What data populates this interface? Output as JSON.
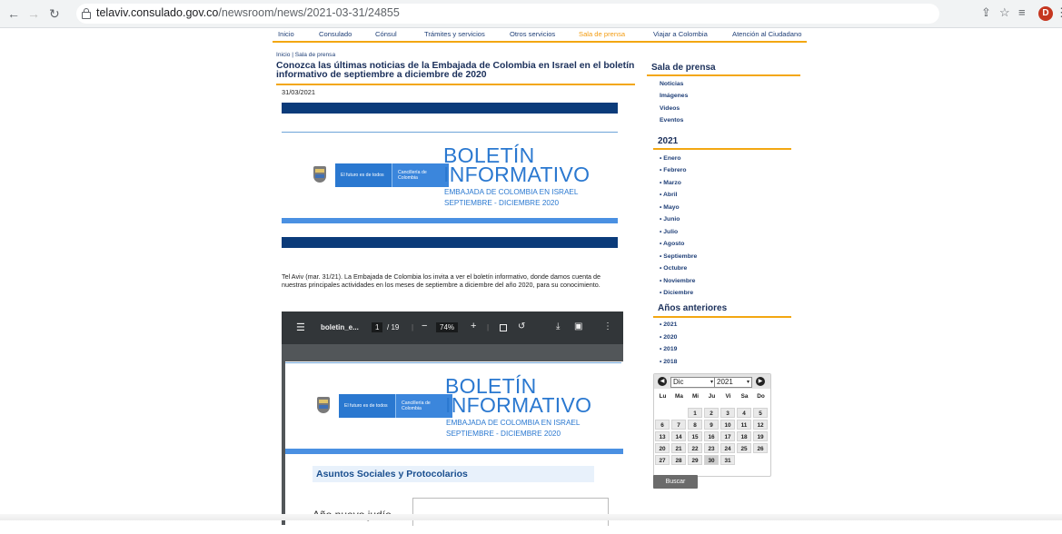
{
  "browser": {
    "url_host": "telaviv.consulado.gov.co",
    "url_path": "/newsroom/news/2021-03-31/24855",
    "avatar_letter": "D"
  },
  "nav": {
    "items": [
      "Inicio",
      "Consulado",
      "Cónsul",
      "Trámites y servicios",
      "Otros servicios",
      "Sala de prensa",
      "Viajar a Colombia",
      "Atención al Ciudadano"
    ],
    "active_index": 5,
    "accent": "#f39c12"
  },
  "article": {
    "breadcrumb": "Inicio | Sala de prensa",
    "title": "Conozca las últimas noticias de la Embajada de Colombia en Israel en el boletín informativo de septiembre a diciembre de 2020",
    "date": "31/03/2021",
    "banner": {
      "logo_left": "El futuro es de todos",
      "logo_right": "Cancillería de Colombia",
      "title_line1": "BOLETÍN",
      "title_line2": "INFORMATIVO",
      "sub1": "EMBAJADA DE COLOMBIA EN ISRAEL",
      "sub2": "SEPTIEMBRE - DICIEMBRE 2020"
    },
    "intro": "Tel Aviv (mar. 31/21). La Embajada de Colombia los invita a ver el boletín informativo, donde damos cuenta de nuestras principales actividades en los meses de septiembre a diciembre del año 2020, para su conocimiento."
  },
  "pdf": {
    "filename": "boletin_e...",
    "page": "1",
    "pages": "/ 19",
    "zoom": "74%",
    "section": "Asuntos Sociales y Protocolarios",
    "item": "Año nuevo judío"
  },
  "sidebar": {
    "heading": "Sala de prensa",
    "links": [
      "Noticias",
      "Imágenes",
      "Videos",
      "Eventos"
    ],
    "year_heading": "2021",
    "months": [
      "Enero",
      "Febrero",
      "Marzo",
      "Abril",
      "Mayo",
      "Junio",
      "Julio",
      "Agosto",
      "Septiembre",
      "Octubre",
      "Noviembre",
      "Diciembre"
    ],
    "prev_heading": "Años anteriores",
    "prev_years": [
      "2021",
      "2020",
      "2019",
      "2018"
    ]
  },
  "calendar": {
    "month": "Dic",
    "year": "2021",
    "weekdays": [
      "Lu",
      "Ma",
      "Mi",
      "Ju",
      "Vi",
      "Sa",
      "Do"
    ],
    "first_weekday_index": 2,
    "days_in_month": 31,
    "selected_day": 30,
    "search_label": "Buscar"
  }
}
